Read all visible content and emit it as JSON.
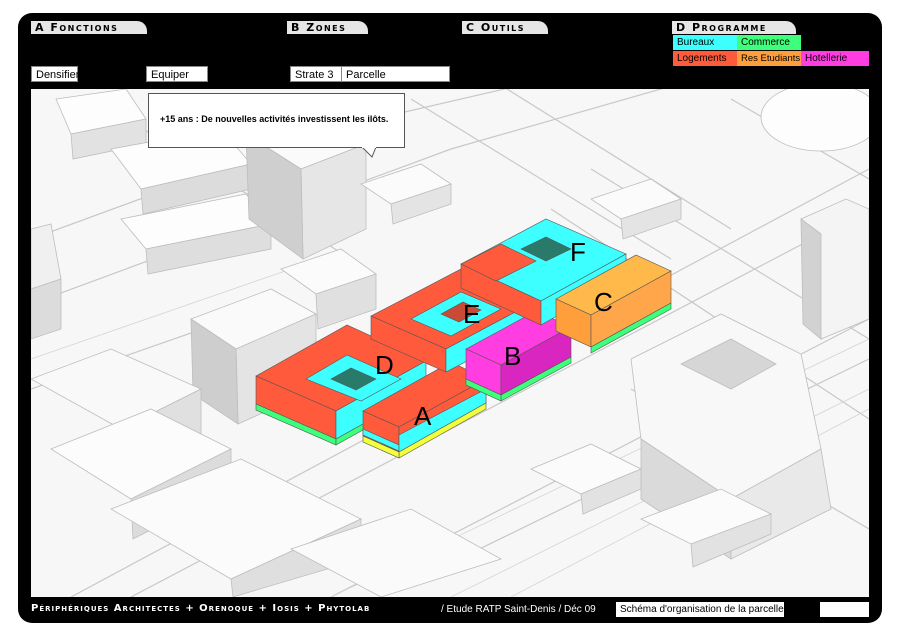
{
  "header": {
    "tabs": [
      {
        "label": "A Fonctions"
      },
      {
        "label": "B Zones"
      },
      {
        "label": "C Outils"
      },
      {
        "label": "D Programme"
      }
    ]
  },
  "programme": {
    "items": [
      {
        "label": "Bureaux",
        "color": "#3dffff"
      },
      {
        "label": "Commerce",
        "color": "#3dff7a"
      },
      {
        "label": "Logements",
        "color": "#ff5a3c"
      },
      {
        "label": "Res Etudiants",
        "color": "#ff9f3c"
      },
      {
        "label": "Hotellerie",
        "color": "#ff3de0"
      }
    ]
  },
  "fields": {
    "densifier": "Densifier",
    "equiper": "Equiper",
    "strate": "Strate 3",
    "parcelle": "Parcelle"
  },
  "callout": {
    "emphasis": "+15 ans",
    "text": " : De nouvelles activités investissent les ilôts."
  },
  "blocks": [
    {
      "label": "A"
    },
    {
      "label": "B"
    },
    {
      "label": "C"
    },
    {
      "label": "D"
    },
    {
      "label": "E"
    },
    {
      "label": "F"
    }
  ],
  "footer": {
    "credits": "Périphériques Architectes + Orenoque + Iosis + Phytolab",
    "study": "/ Etude RATP Saint-Denis / Déc 09",
    "caption": "Schéma d'organisation de la parcelle",
    "blank": ""
  }
}
